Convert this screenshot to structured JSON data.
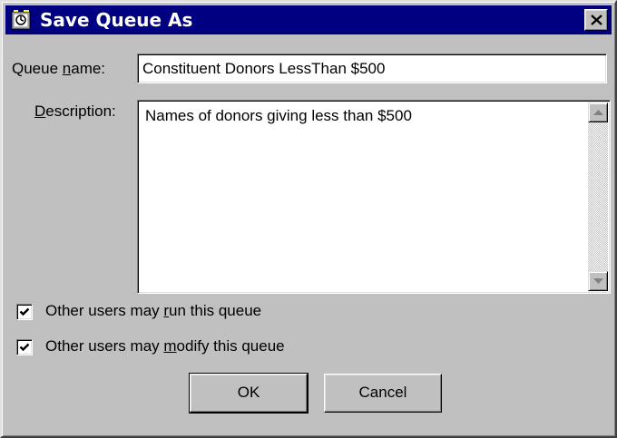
{
  "window": {
    "title": "Save Queue As",
    "icon": "queue-app-icon",
    "close_icon": "close-icon"
  },
  "queue_name": {
    "label_pre": "Queue ",
    "label_accel": "n",
    "label_post": "ame:",
    "value": "Constituent Donors LessThan $500"
  },
  "description": {
    "label_pre": "",
    "label_accel": "D",
    "label_post": "escription:",
    "value": "Names of donors giving less than $500"
  },
  "options": [
    {
      "label_pre": "Other users may ",
      "label_accel": "r",
      "label_post": "un this queue",
      "checked": true
    },
    {
      "label_pre": "Other users may ",
      "label_accel": "m",
      "label_post": "odify this queue",
      "checked": true
    }
  ],
  "buttons": {
    "ok": "OK",
    "cancel": "Cancel"
  },
  "colors": {
    "titlebar": "#000080",
    "face": "#c0c0c0"
  }
}
